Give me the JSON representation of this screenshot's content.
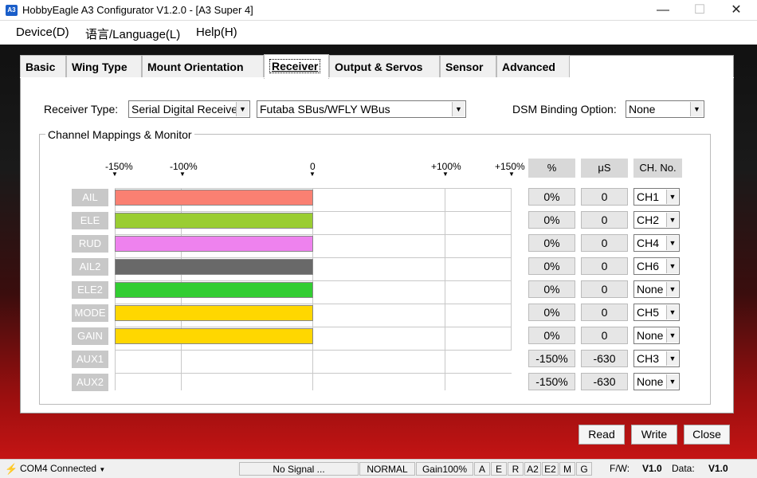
{
  "window": {
    "icon_text": "A3",
    "title": "HobbyEagle A3 Configurator V1.2.0 - [A3 Super 4]",
    "minimize_glyph": "—",
    "maximize_glyph": "☐",
    "close_glyph": "✕"
  },
  "menu": [
    "Device(D)",
    "语言/Language(L)",
    "Help(H)"
  ],
  "tabs": [
    "Basic",
    "Wing Type",
    "Mount Orientation",
    "Receiver",
    "Output & Servos",
    "Sensor",
    "Advanced"
  ],
  "active_tab": "Receiver",
  "receiver": {
    "type_label": "Receiver Type:",
    "type_value": "Serial Digital Receive",
    "protocol_value": "Futaba SBus/WFLY WBus",
    "dsm_label": "DSM Binding Option:",
    "dsm_value": "None"
  },
  "group_title": "Channel Mappings & Monitor",
  "scale": {
    "labels": [
      "-150%",
      "-100%",
      "0",
      "+100%",
      "+150%"
    ],
    "values": [
      -150,
      -100,
      0,
      100,
      150
    ]
  },
  "columns": {
    "percent": "%",
    "us": "μS",
    "ch": "CH. No."
  },
  "channels": [
    {
      "name": "AIL",
      "percent": "0%",
      "us": "0",
      "ch": "CH1",
      "value": 0,
      "color": "#fa8072"
    },
    {
      "name": "ELE",
      "percent": "0%",
      "us": "0",
      "ch": "CH2",
      "value": 0,
      "color": "#9acd32"
    },
    {
      "name": "RUD",
      "percent": "0%",
      "us": "0",
      "ch": "CH4",
      "value": 0,
      "color": "#ee82ee"
    },
    {
      "name": "AIL2",
      "percent": "0%",
      "us": "0",
      "ch": "CH6",
      "value": 0,
      "color": "#696969"
    },
    {
      "name": "ELE2",
      "percent": "0%",
      "us": "0",
      "ch": "None",
      "value": 0,
      "color": "#32cd32"
    },
    {
      "name": "MODE",
      "percent": "0%",
      "us": "0",
      "ch": "CH5",
      "value": 0,
      "color": "#ffd700"
    },
    {
      "name": "GAIN",
      "percent": "0%",
      "us": "0",
      "ch": "None",
      "value": 0,
      "color": "#ffd700"
    },
    {
      "name": "AUX1",
      "percent": "-150%",
      "us": "-630",
      "ch": "CH3",
      "value": -150,
      "color": ""
    },
    {
      "name": "AUX2",
      "percent": "-150%",
      "us": "-630",
      "ch": "None",
      "value": -150,
      "color": ""
    }
  ],
  "buttons": {
    "read": "Read",
    "write": "Write",
    "close": "Close"
  },
  "status": {
    "port": "COM4 Connected",
    "signal": "No Signal ...",
    "mode": "NORMAL",
    "gain": "Gain100%",
    "indicators": [
      "A",
      "E",
      "R",
      "A2",
      "E2",
      "M",
      "G"
    ],
    "fw_label": "F/W:",
    "fw_value": "V1.0",
    "data_label": "Data:",
    "data_value": "V1.0"
  }
}
